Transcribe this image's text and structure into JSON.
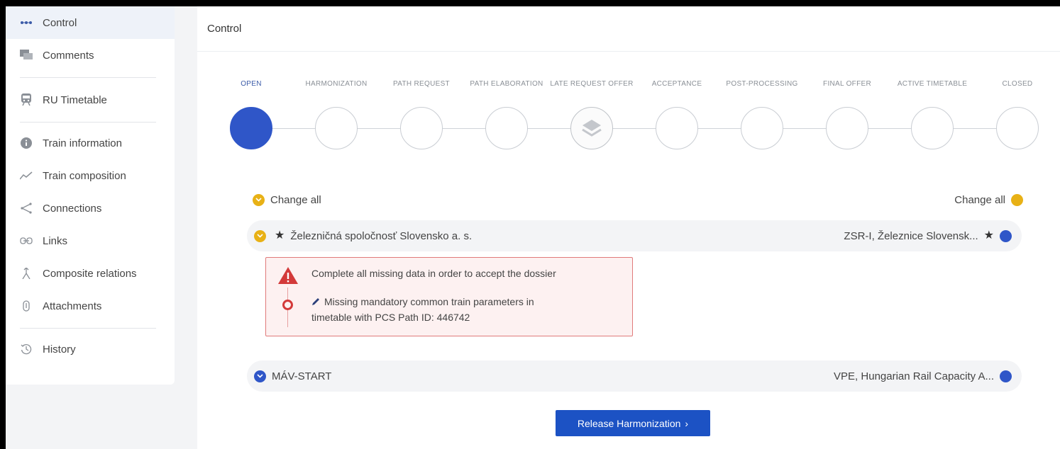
{
  "sidebar": {
    "items": [
      {
        "label": "Control",
        "icon": "dots-icon",
        "active": true
      },
      {
        "label": "Comments",
        "icon": "comments-icon"
      },
      {
        "label": "RU Timetable",
        "icon": "train-icon"
      },
      {
        "label": "Train information",
        "icon": "info-icon"
      },
      {
        "label": "Train composition",
        "icon": "trend-icon"
      },
      {
        "label": "Connections",
        "icon": "share-icon"
      },
      {
        "label": "Links",
        "icon": "link-icon"
      },
      {
        "label": "Composite relations",
        "icon": "branch-icon"
      },
      {
        "label": "Attachments",
        "icon": "paperclip-icon"
      },
      {
        "label": "History",
        "icon": "history-icon"
      }
    ]
  },
  "main": {
    "title": "Control"
  },
  "stepper": {
    "steps": [
      {
        "label": "OPEN",
        "state": "current"
      },
      {
        "label": "HARMONIZATION",
        "state": "pending"
      },
      {
        "label": "PATH REQUEST",
        "state": "pending"
      },
      {
        "label": "PATH ELABORATION",
        "state": "pending"
      },
      {
        "label": "LATE REQUEST OFFER",
        "state": "layered"
      },
      {
        "label": "ACCEPTANCE",
        "state": "pending"
      },
      {
        "label": "POST-PROCESSING",
        "state": "pending"
      },
      {
        "label": "FINAL OFFER",
        "state": "pending"
      },
      {
        "label": "ACTIVE TIMETABLE",
        "state": "pending"
      },
      {
        "label": "CLOSED",
        "state": "pending"
      }
    ]
  },
  "change_all": {
    "left": "Change all",
    "right": "Change all"
  },
  "parties": [
    {
      "left": "Železničná spoločnosť Slovensko a. s.",
      "right": "ZSR-I, Železnice Slovensk..."
    },
    {
      "left": "MÁV-START",
      "right": "VPE, Hungarian Rail Capacity A..."
    }
  ],
  "alert": {
    "title": "Complete all missing data in order to accept the dossier",
    "line1": "Missing mandatory common train parameters in",
    "line2": "timetable with PCS Path ID: 446742"
  },
  "release_button": {
    "label": "Release Harmonization",
    "chevron": "›"
  },
  "colors": {
    "accent": "#2f56c8",
    "button": "#1c52c4",
    "warning": "#e8b116",
    "error": "#d33a3a"
  }
}
